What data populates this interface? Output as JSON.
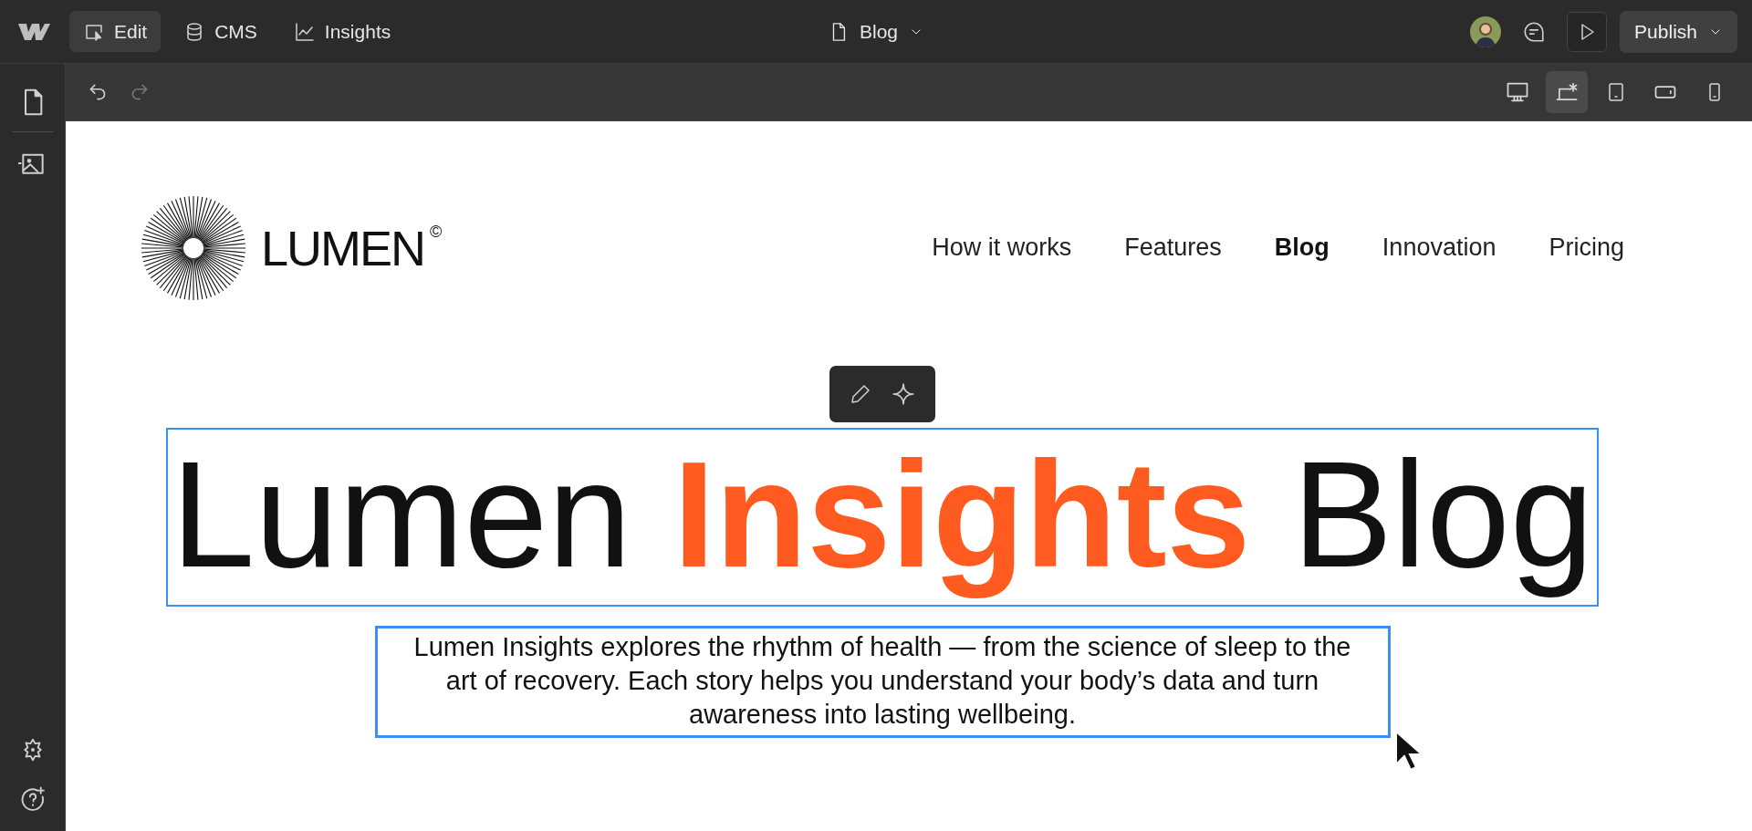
{
  "topbar": {
    "modes": [
      {
        "kind": "edit",
        "label": "Edit",
        "selected": true
      },
      {
        "kind": "cms",
        "label": "CMS",
        "selected": false
      },
      {
        "kind": "insights",
        "label": "Insights",
        "selected": false
      }
    ],
    "page": "Blog",
    "publish": "Publish"
  },
  "history": {
    "undo_disabled": false,
    "redo_disabled": true
  },
  "devices": [
    {
      "kind": "desktop",
      "selected": false
    },
    {
      "kind": "laptop",
      "selected": true
    },
    {
      "kind": "tablet",
      "selected": false
    },
    {
      "kind": "landscape",
      "selected": false
    },
    {
      "kind": "phone",
      "selected": false
    }
  ],
  "site": {
    "logo": "LUMEN",
    "logo_mark": "©",
    "nav": [
      {
        "label": "How it works",
        "selected": false
      },
      {
        "label": "Features",
        "selected": false
      },
      {
        "label": "Blog",
        "selected": true
      },
      {
        "label": "Innovation",
        "selected": false
      },
      {
        "label": "Pricing",
        "selected": false
      }
    ],
    "heading": [
      {
        "text": "Lumen",
        "accent": false
      },
      {
        "text": "Insights",
        "accent": true
      },
      {
        "text": "Blog",
        "accent": false
      }
    ],
    "paragraph": "Lumen Insights explores the rhythm of health — from the science of sleep to the art of recovery. Each story helps you understand your body’s data and turn awareness into lasting wellbeing."
  }
}
